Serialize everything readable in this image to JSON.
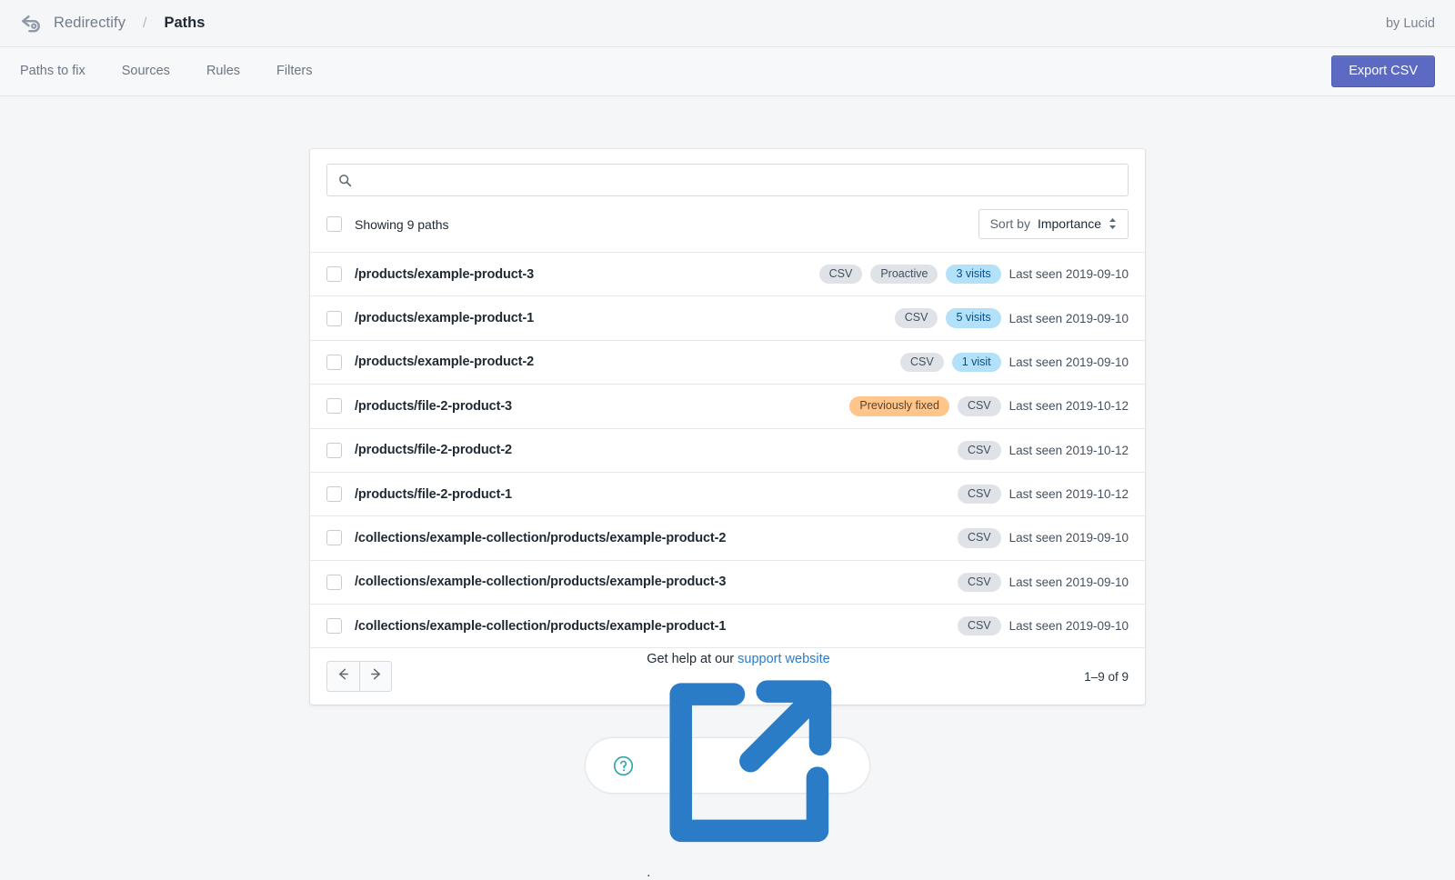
{
  "topbar": {
    "logo_icon": "redirect-arrow-icon",
    "brand": "Redirectify",
    "separator": "/",
    "current": "Paths",
    "byline": "by Lucid"
  },
  "nav": {
    "tabs": [
      {
        "label": "Paths to fix"
      },
      {
        "label": "Sources"
      },
      {
        "label": "Rules"
      },
      {
        "label": "Filters"
      }
    ],
    "export_label": "Export CSV",
    "export_color": "#5c6ac4"
  },
  "search": {
    "icon": "search-icon",
    "value": "",
    "placeholder": ""
  },
  "toolbar": {
    "showing_label": "Showing 9 paths",
    "sort_prefix": "Sort by",
    "sort_value": "Importance",
    "sort_icon": "caret-up-down-icon"
  },
  "rows": [
    {
      "path": "/products/example-product-3",
      "badges": [
        {
          "label": "CSV",
          "tone": "gray"
        },
        {
          "label": "Proactive",
          "tone": "gray"
        },
        {
          "label": "3 visits",
          "tone": "blue"
        }
      ],
      "last_seen": "Last seen 2019-09-10"
    },
    {
      "path": "/products/example-product-1",
      "badges": [
        {
          "label": "CSV",
          "tone": "gray"
        },
        {
          "label": "5 visits",
          "tone": "blue"
        }
      ],
      "last_seen": "Last seen 2019-09-10"
    },
    {
      "path": "/products/example-product-2",
      "badges": [
        {
          "label": "CSV",
          "tone": "gray"
        },
        {
          "label": "1 visit",
          "tone": "blue"
        }
      ],
      "last_seen": "Last seen 2019-09-10"
    },
    {
      "path": "/products/file-2-product-3",
      "badges": [
        {
          "label": "Previously fixed",
          "tone": "orange"
        },
        {
          "label": "CSV",
          "tone": "gray"
        }
      ],
      "last_seen": "Last seen 2019-10-12"
    },
    {
      "path": "/products/file-2-product-2",
      "badges": [
        {
          "label": "CSV",
          "tone": "gray"
        }
      ],
      "last_seen": "Last seen 2019-10-12"
    },
    {
      "path": "/products/file-2-product-1",
      "badges": [
        {
          "label": "CSV",
          "tone": "gray"
        }
      ],
      "last_seen": "Last seen 2019-10-12"
    },
    {
      "path": "/collections/example-collection/products/example-product-2",
      "badges": [
        {
          "label": "CSV",
          "tone": "gray"
        }
      ],
      "last_seen": "Last seen 2019-09-10"
    },
    {
      "path": "/collections/example-collection/products/example-product-3",
      "badges": [
        {
          "label": "CSV",
          "tone": "gray"
        }
      ],
      "last_seen": "Last seen 2019-09-10"
    },
    {
      "path": "/collections/example-collection/products/example-product-1",
      "badges": [
        {
          "label": "CSV",
          "tone": "gray"
        }
      ],
      "last_seen": "Last seen 2019-09-10"
    }
  ],
  "pagination": {
    "prev_icon": "arrow-left-icon",
    "next_icon": "arrow-right-icon",
    "count_label": "1–9 of 9"
  },
  "help": {
    "icon": "question-circle-icon",
    "text_before": "Get help at our",
    "link_label": "support website",
    "external_icon": "external-link-icon",
    "text_after": "."
  },
  "colors": {
    "page_bg": "#f4f6f8",
    "accent": "#5c6ac4",
    "badge_gray": "#dfe3e8",
    "badge_blue": "#b4e1fa",
    "badge_orange": "#ffc58b",
    "link": "#2a7cc7",
    "help_icon": "#2aa5a5"
  }
}
